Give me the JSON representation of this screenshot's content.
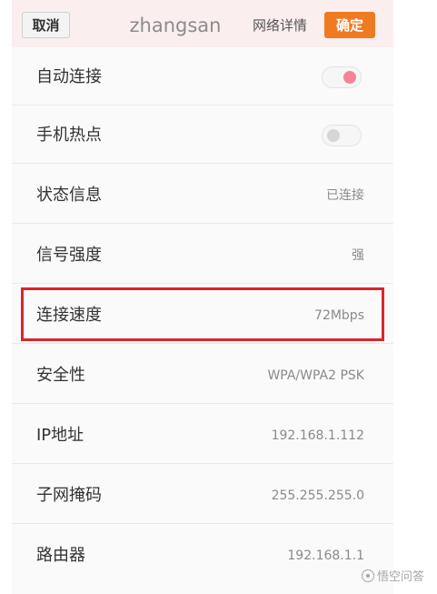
{
  "header": {
    "cancel_label": "取消",
    "ssid": "zhangsan",
    "details_label": "网络详情",
    "confirm_label": "确定"
  },
  "rows": [
    {
      "label": "自动连接",
      "toggle": "on",
      "toggle_color": "#f3859b"
    },
    {
      "label": "手机热点",
      "toggle": "off"
    },
    {
      "label": "状态信息",
      "value": "已连接"
    },
    {
      "label": "信号强度",
      "value": "强"
    },
    {
      "label": "连接速度",
      "value": "72Mbps",
      "highlighted": true,
      "highlight_color": "#d9262c"
    },
    {
      "label": "安全性",
      "value": "WPA/WPA2 PSK"
    },
    {
      "label": "IP地址",
      "value": "192.168.1.112"
    },
    {
      "label": "子网掩码",
      "value": "255.255.255.0"
    },
    {
      "label": "路由器",
      "value": "192.168.1.1"
    }
  ],
  "watermark": {
    "text": "悟空问答",
    "icon": "wukong-logo-icon"
  },
  "colors": {
    "accent": "#f07a22",
    "header_background": "#fbeeee"
  }
}
